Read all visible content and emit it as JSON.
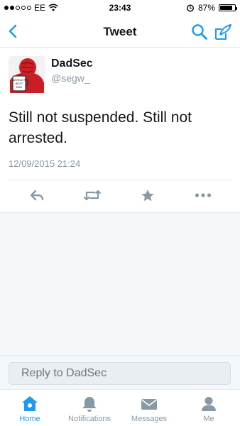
{
  "status_bar": {
    "carrier": "EE",
    "time": "23:43",
    "battery_percent": "87%",
    "battery_level": 0.87,
    "signal_bars_filled": 2,
    "signal_bars_total": 5,
    "icons": [
      "signal-dots-icon",
      "wifi-icon",
      "alarm-icon",
      "battery-icon"
    ]
  },
  "nav": {
    "title": "Tweet",
    "back_icon": "chevron-left-icon",
    "search_icon": "search-icon",
    "compose_icon": "compose-icon"
  },
  "tweet": {
    "display_name": "DadSec",
    "handle": "@segw_",
    "text": "Still not suspended. Still not arrested.",
    "timestamp": "12/09/2015 21:24",
    "avatar_sign_text": "WORLD'S BEST DAD",
    "actions": [
      "reply-icon",
      "retweet-icon",
      "favorite-icon",
      "more-icon"
    ]
  },
  "reply": {
    "placeholder": "Reply to DadSec"
  },
  "tabs": [
    {
      "label": "Home",
      "icon": "home-icon",
      "active": true
    },
    {
      "label": "Notifications",
      "icon": "bell-icon",
      "active": false
    },
    {
      "label": "Messages",
      "icon": "envelope-icon",
      "active": false
    },
    {
      "label": "Me",
      "icon": "person-icon",
      "active": false
    }
  ],
  "colors": {
    "accent": "#1d9bf0",
    "muted": "#8899a6",
    "text": "#14171a",
    "background_gray": "#f5f8fa"
  }
}
